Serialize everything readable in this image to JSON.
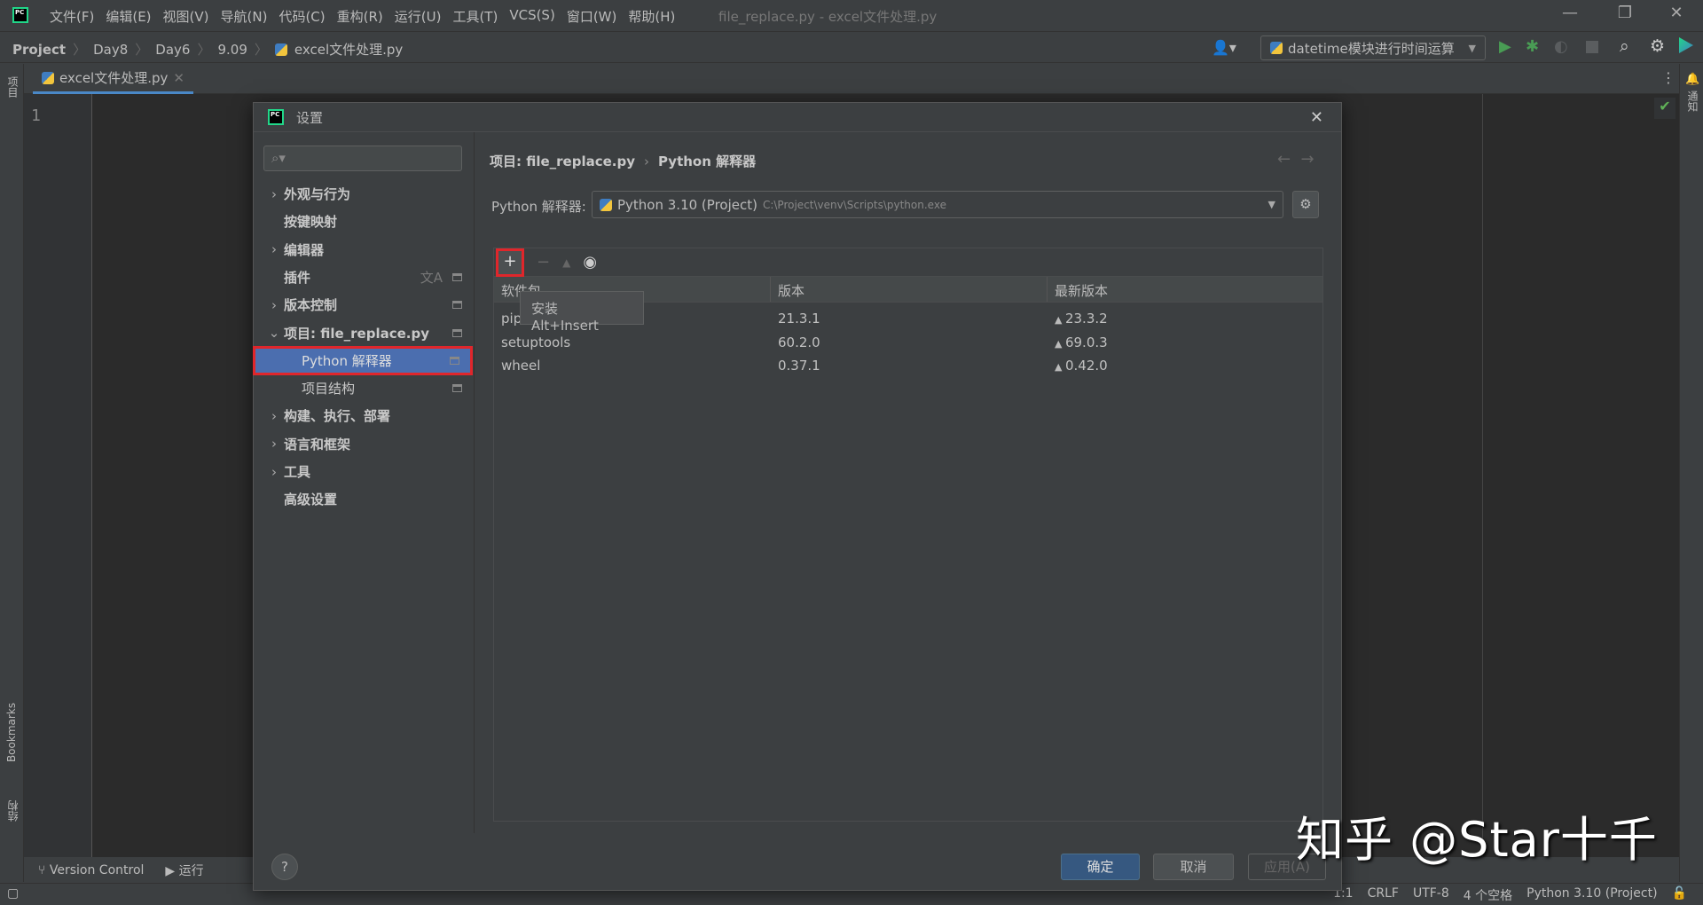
{
  "app": {
    "menu": [
      "文件(F)",
      "编辑(E)",
      "视图(V)",
      "导航(N)",
      "代码(C)",
      "重构(R)",
      "运行(U)",
      "工具(T)",
      "VCS(S)",
      "窗口(W)",
      "帮助(H)"
    ],
    "window_title": "file_replace.py - excel文件处理.py",
    "logo_text": "PC"
  },
  "breadcrumb": [
    "Project",
    "Day8",
    "Day6",
    "9.09",
    "excel文件处理.py"
  ],
  "run_config": "datetime模块进行时间运算",
  "editor": {
    "tab": "excel文件处理.py",
    "line_number": "1"
  },
  "left_strip": {
    "project": "项目",
    "bookmarks": "Bookmarks",
    "structure": "结构"
  },
  "right_strip": {
    "notifications": "通知"
  },
  "dialog": {
    "title": "设置",
    "search_placeholder": "",
    "tree": [
      {
        "label": "外观与行为",
        "expandable": true
      },
      {
        "label": "按键映射"
      },
      {
        "label": "编辑器",
        "expandable": true
      },
      {
        "label": "插件",
        "marker": true
      },
      {
        "label": "版本控制",
        "expandable": true,
        "marker": true
      },
      {
        "label": "项目: file_replace.py",
        "expanded": true,
        "marker": true
      },
      {
        "label": "Python 解释器",
        "child": true,
        "selected": true,
        "marker": true
      },
      {
        "label": "项目结构",
        "child": true,
        "marker": true
      },
      {
        "label": "构建、执行、部署",
        "expandable": true
      },
      {
        "label": "语言和框架",
        "expandable": true
      },
      {
        "label": "工具",
        "expandable": true
      },
      {
        "label": "高级设置"
      }
    ],
    "crumb_parent": "项目: file_replace.py",
    "crumb_current": "Python 解释器",
    "interpreter_label": "Python 解释器:",
    "interpreter_name": "Python 3.10 (Project)",
    "interpreter_path": "C:\\Project\\venv\\Scripts\\python.exe",
    "columns": [
      "软件包",
      "版本",
      "最新版本"
    ],
    "packages": [
      {
        "name": "pip",
        "version": "21.3.1",
        "latest": "23.3.2"
      },
      {
        "name": "setuptools",
        "version": "60.2.0",
        "latest": "69.0.3"
      },
      {
        "name": "wheel",
        "version": "0.37.1",
        "latest": "0.42.0"
      }
    ],
    "tooltip": {
      "label": "安装",
      "shortcut": "Alt+Insert"
    },
    "ok": "确定",
    "cancel": "取消",
    "apply": "应用(A)",
    "help": "?"
  },
  "toolwindows": [
    "Version Control",
    "运行"
  ],
  "status": {
    "position": "1:1",
    "line_sep": "CRLF",
    "encoding": "UTF-8",
    "indent": "4 个空格",
    "interpreter": "Python 3.10 (Project)"
  },
  "watermark": "知乎 @Star十千",
  "colors": {
    "selection": "#4b6eaf",
    "highlight": "#e0262b",
    "ok_button": "#365880"
  }
}
